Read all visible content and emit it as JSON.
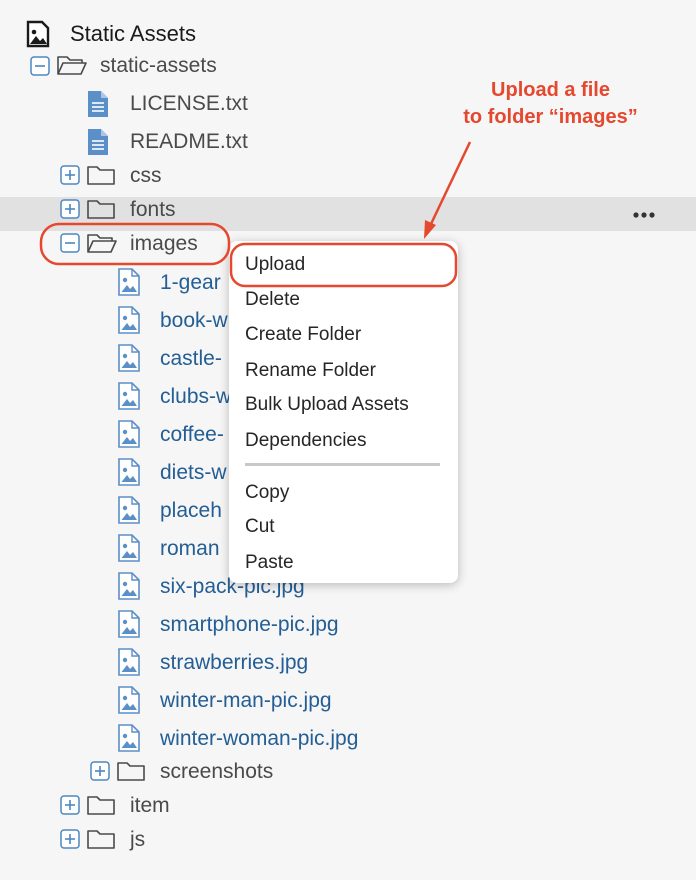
{
  "tree": {
    "root_label": "Static Assets",
    "items": [
      {
        "label": "static-assets",
        "kind": "folder-open"
      },
      {
        "label": "LICENSE.txt",
        "kind": "file"
      },
      {
        "label": "README.txt",
        "kind": "file"
      },
      {
        "label": "css",
        "kind": "folder"
      },
      {
        "label": "fonts",
        "kind": "folder"
      },
      {
        "label": "images",
        "kind": "folder-open"
      },
      {
        "label": "1-gear",
        "kind": "image"
      },
      {
        "label": "book-w",
        "kind": "image"
      },
      {
        "label": "castle-",
        "kind": "image"
      },
      {
        "label": "clubs-w",
        "kind": "image"
      },
      {
        "label": "coffee-",
        "kind": "image"
      },
      {
        "label": "diets-w",
        "kind": "image"
      },
      {
        "label": "placeh",
        "kind": "image"
      },
      {
        "label": "roman",
        "kind": "image"
      },
      {
        "label": "six-pack-pic.jpg",
        "kind": "image"
      },
      {
        "label": "smartphone-pic.jpg",
        "kind": "image"
      },
      {
        "label": "strawberries.jpg",
        "kind": "image"
      },
      {
        "label": "winter-man-pic.jpg",
        "kind": "image"
      },
      {
        "label": "winter-woman-pic.jpg",
        "kind": "image"
      },
      {
        "label": "screenshots",
        "kind": "folder"
      },
      {
        "label": "item",
        "kind": "folder"
      },
      {
        "label": "js",
        "kind": "folder"
      }
    ]
  },
  "context_menu": {
    "items": [
      "Upload",
      "Delete",
      "Create Folder",
      "Rename Folder",
      "Bulk Upload Assets",
      "Dependencies",
      "Copy",
      "Cut",
      "Paste"
    ]
  },
  "annotation": {
    "line1": "Upload a file",
    "line2": "to folder “images”"
  },
  "colors": {
    "accent": "#e5472f",
    "link_blue": "#235e94",
    "icon_blue": "#5b8fc7",
    "hover_row": "#e1e1e1"
  }
}
